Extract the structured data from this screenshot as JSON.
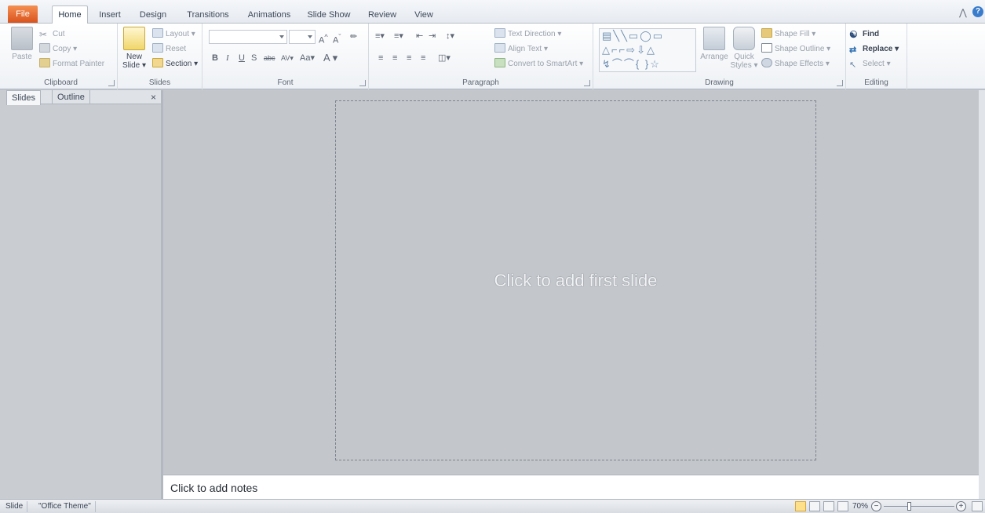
{
  "tabs": [
    {
      "label": "File"
    },
    {
      "label": "Home"
    },
    {
      "label": "Insert"
    },
    {
      "label": "Design"
    },
    {
      "label": "Transitions"
    },
    {
      "label": "Animations"
    },
    {
      "label": "Slide Show"
    },
    {
      "label": "Review"
    },
    {
      "label": "View"
    }
  ],
  "ribbon": {
    "clipboard": {
      "label": "Clipboard",
      "paste": "Paste",
      "cut": "Cut",
      "copy": "Copy",
      "format_painter": "Format Painter"
    },
    "slides": {
      "label": "Slides",
      "new_slide_line1": "New",
      "new_slide_line2": "Slide",
      "layout": "Layout",
      "reset": "Reset",
      "section": "Section"
    },
    "font": {
      "label": "Font",
      "font_name": "",
      "font_size": ""
    },
    "paragraph": {
      "label": "Paragraph",
      "text_direction": "Text Direction",
      "align_text": "Align Text",
      "convert_smartart": "Convert to SmartArt"
    },
    "drawing": {
      "label": "Drawing",
      "arrange": "Arrange",
      "quick_styles_line1": "Quick",
      "quick_styles_line2": "Styles",
      "shape_fill": "Shape Fill",
      "shape_outline": "Shape Outline",
      "shape_effects": "Shape Effects"
    },
    "editing": {
      "label": "Editing",
      "find": "Find",
      "replace": "Replace",
      "select": "Select"
    }
  },
  "left_pane": {
    "tab_slides": "Slides",
    "tab_outline": "Outline",
    "close": "×"
  },
  "slide": {
    "placeholder": "Click to add first slide"
  },
  "notes": {
    "placeholder": "Click to add notes"
  },
  "status": {
    "slide": "Slide",
    "theme": "\"Office Theme\"",
    "zoom": "70%"
  },
  "colors": {
    "file_tab": "#e05a22",
    "accent": "#3a7ccc"
  }
}
